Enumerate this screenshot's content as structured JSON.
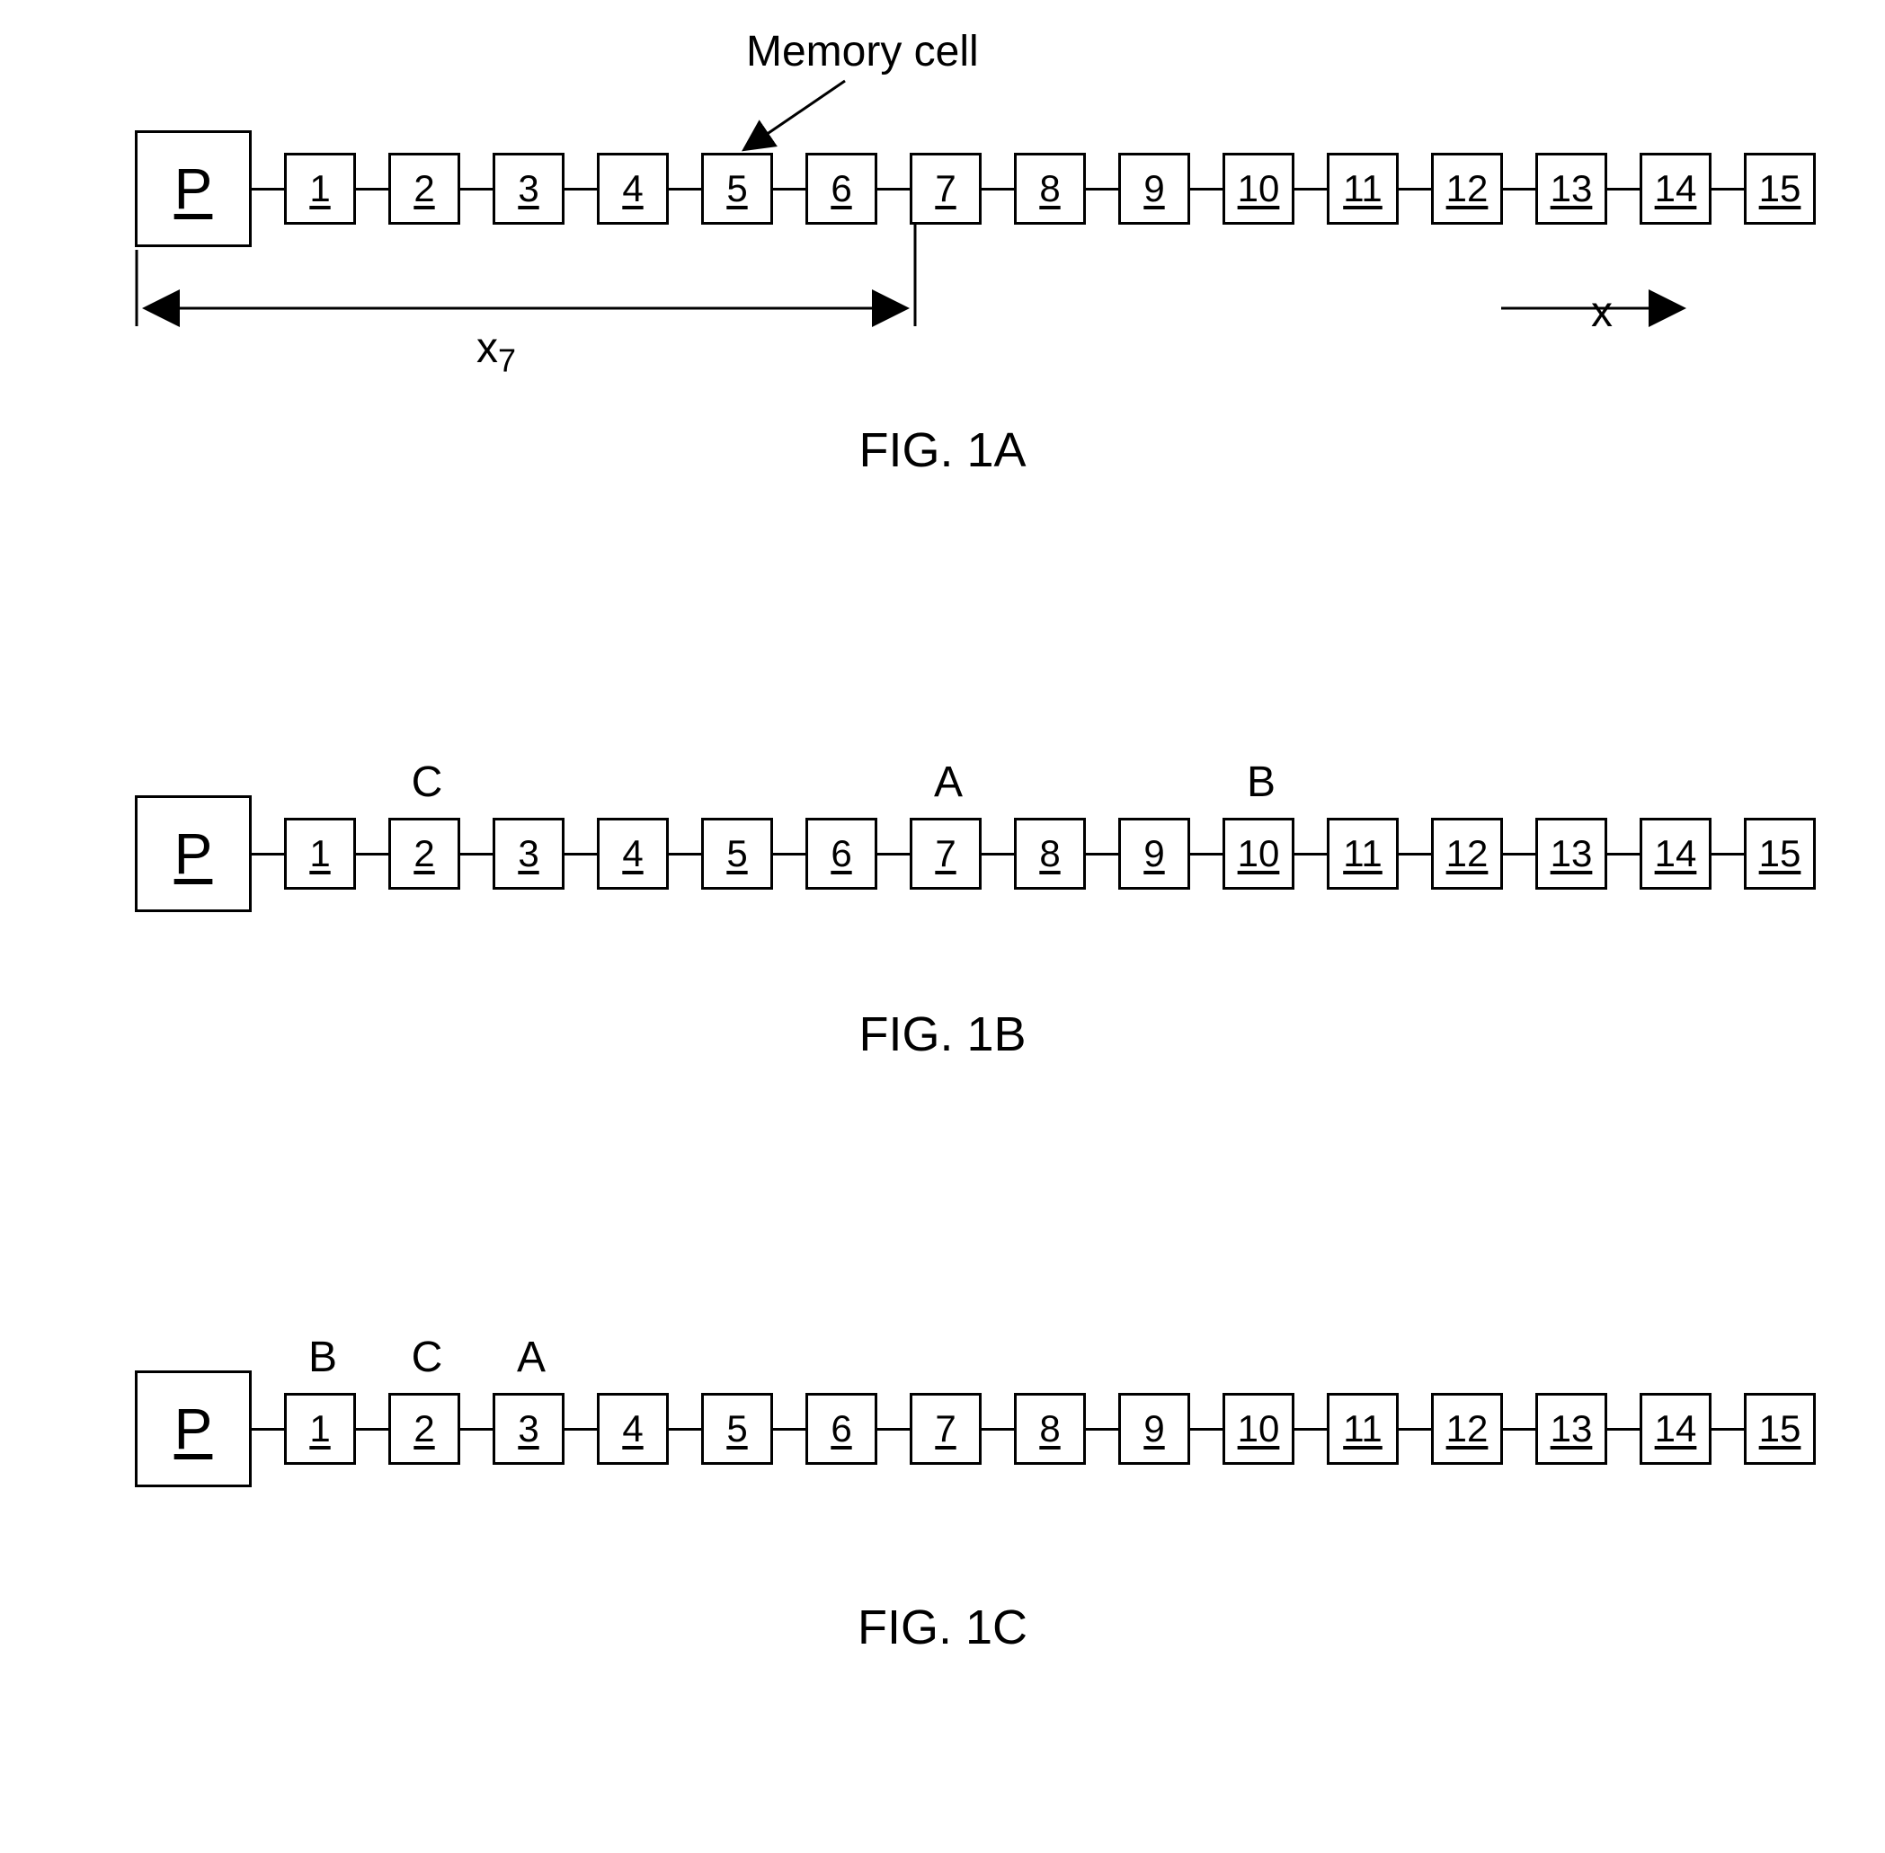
{
  "common": {
    "p_label": "P",
    "cell_count": 15,
    "cells": [
      "1",
      "2",
      "3",
      "4",
      "5",
      "6",
      "7",
      "8",
      "9",
      "10",
      "11",
      "12",
      "13",
      "14",
      "15"
    ]
  },
  "figA": {
    "callout_label": "Memory cell",
    "callout_target_index": 5,
    "dim_label_base": "x",
    "dim_label_sub": "7",
    "axis_label": "x",
    "caption": "FIG. 1A"
  },
  "figB": {
    "labels": {
      "2": "C",
      "7": "A",
      "10": "B"
    },
    "caption": "FIG. 1B"
  },
  "figC": {
    "labels": {
      "1": "B",
      "2": "C",
      "3": "A"
    },
    "caption": "FIG. 1C"
  }
}
